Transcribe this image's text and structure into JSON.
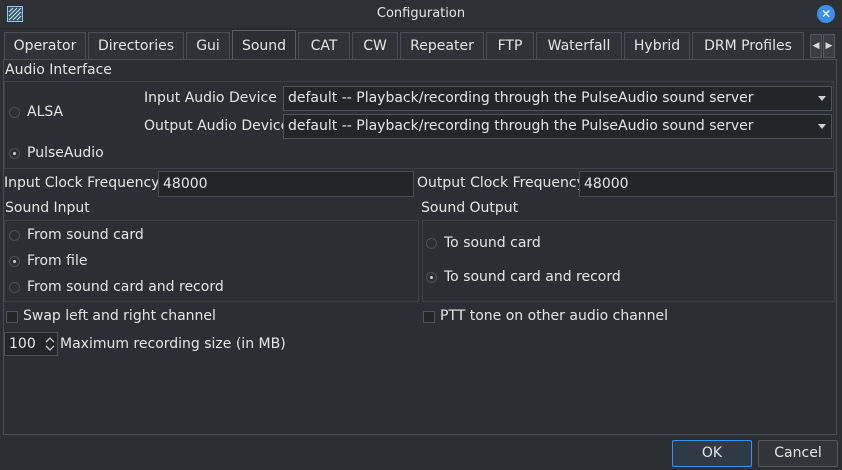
{
  "window": {
    "title": "Configuration"
  },
  "tabs": [
    "Operator",
    "Directories",
    "Gui",
    "Sound",
    "CAT",
    "CW",
    "Repeater",
    "FTP",
    "Waterfall",
    "Hybrid",
    "DRM Profiles"
  ],
  "active_tab": "Sound",
  "audio_interface": {
    "title": "Audio Interface",
    "alsa_label": "ALSA",
    "pulseaudio_label": "PulseAudio",
    "selected": "PulseAudio",
    "input_device_label": "Input Audio Device",
    "input_device_value": "default -- Playback/recording through the PulseAudio sound server",
    "output_device_label": "Output Audio Device",
    "output_device_value": "default -- Playback/recording through the PulseAudio sound server"
  },
  "clock": {
    "input_label": "Input  Clock Frequency",
    "input_value": "48000",
    "output_label": "Output Clock Frequency",
    "output_value": "48000"
  },
  "sound_input": {
    "title": "Sound Input",
    "options": [
      "From sound card",
      "From file",
      "From sound card and record"
    ],
    "selected": "From file"
  },
  "sound_output": {
    "title": "Sound Output",
    "options": [
      "To sound card",
      "To sound card and record"
    ],
    "selected": "To sound card and record"
  },
  "swap_channels": {
    "label": "Swap left and right channel",
    "checked": false
  },
  "ptt_tone": {
    "label": "PTT tone on other audio channel",
    "checked": false
  },
  "max_recording": {
    "value": "100",
    "label": "Maximum recording size (in MB)"
  },
  "buttons": {
    "ok": "OK",
    "cancel": "Cancel"
  },
  "colors": {
    "accent": "#3d8ee6",
    "background": "#2b2e32",
    "field": "#232629"
  }
}
